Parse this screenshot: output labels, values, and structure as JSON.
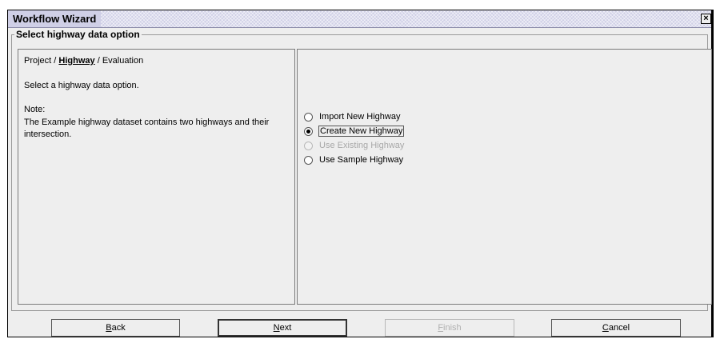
{
  "window": {
    "title": "Workflow Wizard",
    "close_glyph": "×"
  },
  "group": {
    "title": "Select highway data option"
  },
  "left": {
    "breadcrumb": {
      "step1": "Project",
      "sep1": " / ",
      "step2": "Highway",
      "sep2": " / ",
      "step3": "Evaluation"
    },
    "instruction": "Select a highway data option.",
    "note_heading": "Note:",
    "note_body": "The Example highway dataset contains two highways and their intersection."
  },
  "options": [
    {
      "label": "Import New Highway",
      "checked": false,
      "disabled": false
    },
    {
      "label": "Create New Highway",
      "checked": true,
      "disabled": false
    },
    {
      "label": "Use Existing Highway",
      "checked": false,
      "disabled": true
    },
    {
      "label": "Use Sample Highway",
      "checked": false,
      "disabled": false
    }
  ],
  "buttons": {
    "back": {
      "mnemonic": "B",
      "rest": "ack",
      "enabled": true
    },
    "next": {
      "mnemonic": "N",
      "rest": "ext",
      "enabled": true
    },
    "finish": {
      "mnemonic": "F",
      "rest": "inish",
      "enabled": false
    },
    "cancel": {
      "mnemonic": "C",
      "rest": "ancel",
      "enabled": true
    }
  }
}
